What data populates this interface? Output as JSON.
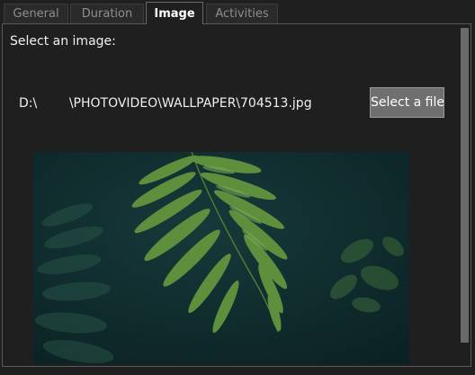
{
  "tabs": [
    {
      "label": "General",
      "active": false
    },
    {
      "label": "Duration",
      "active": false
    },
    {
      "label": "Image",
      "active": true
    },
    {
      "label": "Activities",
      "active": false
    }
  ],
  "content": {
    "prompt": "Select an image:",
    "file_path": "D:\\        \\PHOTOVIDEO\\WALLPAPER\\704513.jpg",
    "select_button_label": "Select a file"
  },
  "preview": {
    "icon": "fern-image"
  },
  "colors": {
    "background": "#1f1f1f",
    "tab_inactive": "#2a2a2a",
    "button": "#6f6f6f",
    "image_bg": "#0f2a2c",
    "fern_green": "#5d8f3c"
  }
}
